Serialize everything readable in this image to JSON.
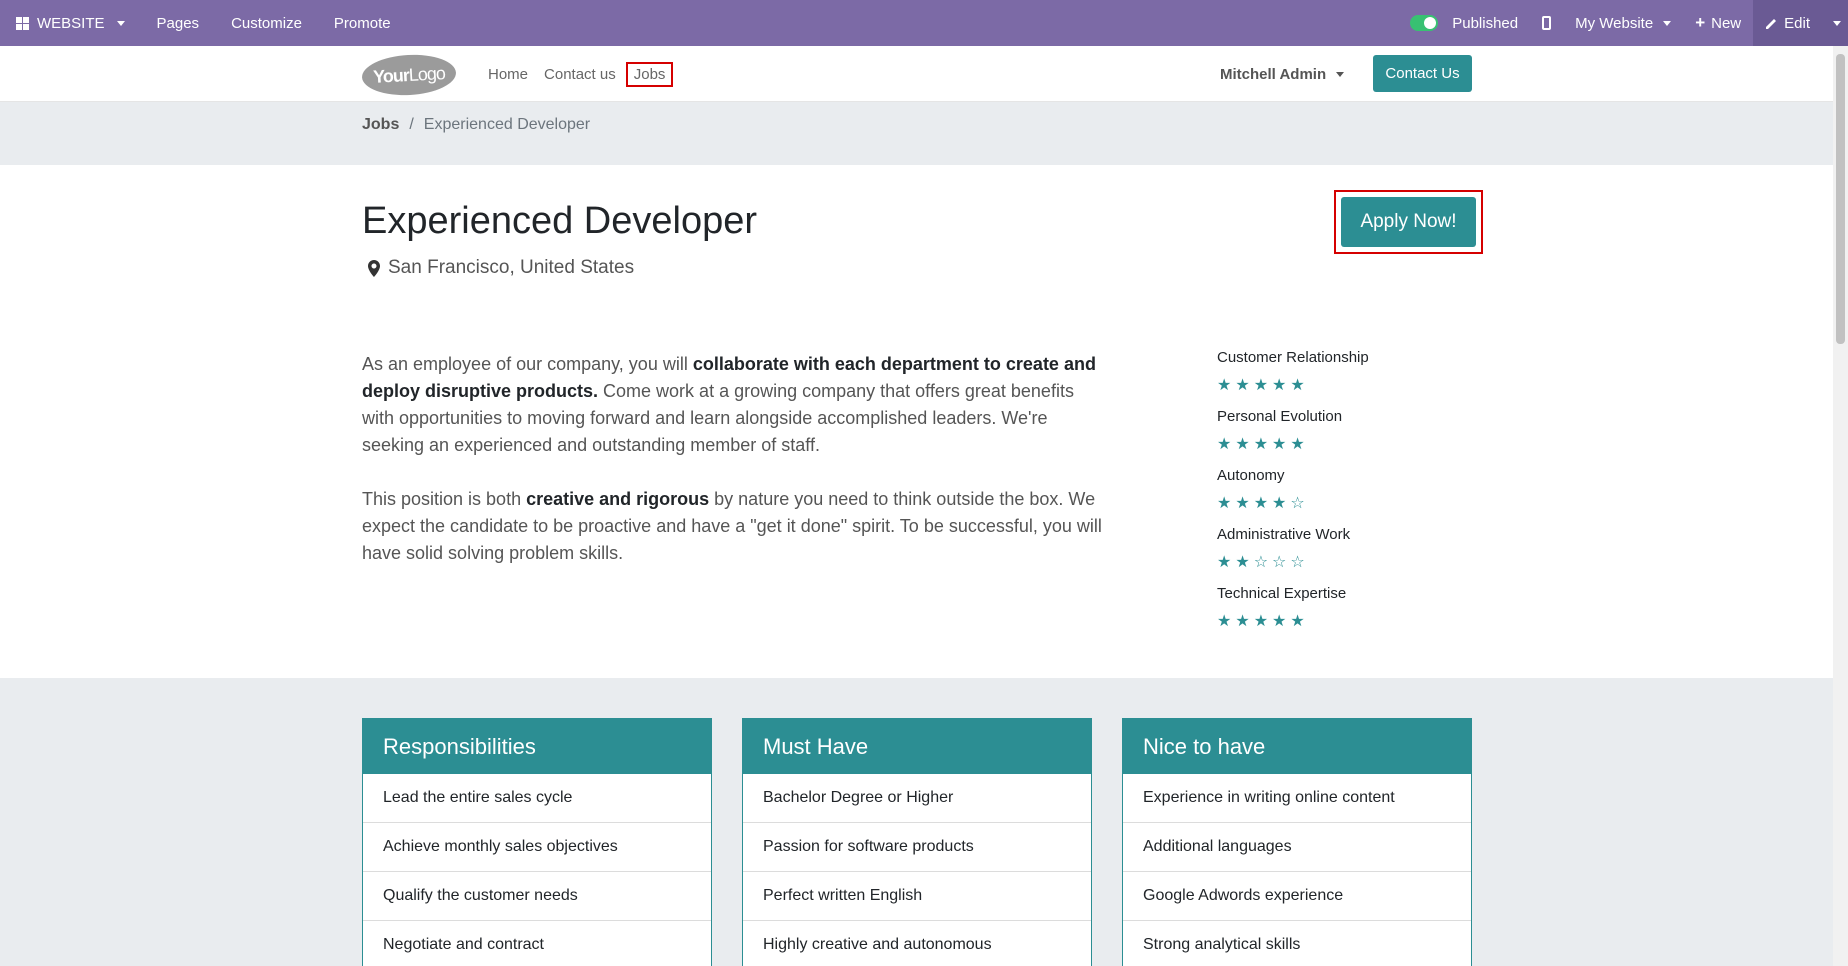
{
  "admin_bar": {
    "app_label": "WEBSITE",
    "links": [
      "Pages",
      "Customize",
      "Promote"
    ],
    "published_label": "Published",
    "website_label": "My Website",
    "new_label": "New",
    "edit_label": "Edit"
  },
  "header": {
    "logo_main": "Your",
    "logo_light": "Logo",
    "nav": [
      "Home",
      "Contact us",
      "Jobs"
    ],
    "user": "Mitchell Admin",
    "cta": "Contact Us"
  },
  "breadcrumb": {
    "root": "Jobs",
    "separator": "/",
    "current": "Experienced Developer"
  },
  "job": {
    "title": "Experienced Developer",
    "city": "San Francisco",
    "country": "United States",
    "apply_label": "Apply Now!",
    "p1_a": "As an employee of our company, you will ",
    "p1_b": "collaborate with each department to create and deploy disruptive products.",
    "p1_c": " Come work at a growing company that offers great benefits with opportunities to moving forward and learn alongside accomplished leaders. We're seeking an experienced and outstanding member of staff.",
    "p2_a": "This position is both ",
    "p2_b": "creative and rigorous",
    "p2_c": " by nature you need to think outside the box. We expect the candidate to be proactive and have a \"get it done\" spirit. To be successful, you will have solid solving problem skills."
  },
  "ratings": [
    {
      "label": "Customer Relationship",
      "stars": 5
    },
    {
      "label": "Personal Evolution",
      "stars": 5
    },
    {
      "label": "Autonomy",
      "stars": 4
    },
    {
      "label": "Administrative Work",
      "stars": 2
    },
    {
      "label": "Technical Expertise",
      "stars": 5
    }
  ],
  "cards": [
    {
      "title": "Responsibilities",
      "items": [
        "Lead the entire sales cycle",
        "Achieve monthly sales objectives",
        "Qualify the customer needs",
        "Negotiate and contract"
      ]
    },
    {
      "title": "Must Have",
      "items": [
        "Bachelor Degree or Higher",
        "Passion for software products",
        "Perfect written English",
        "Highly creative and autonomous"
      ]
    },
    {
      "title": "Nice to have",
      "items": [
        "Experience in writing online content",
        "Additional languages",
        "Google Adwords experience",
        "Strong analytical skills"
      ]
    }
  ],
  "colors": {
    "admin_bar": "#7c6aa6",
    "primary": "#2c8e93",
    "highlight_border": "#d50000"
  }
}
